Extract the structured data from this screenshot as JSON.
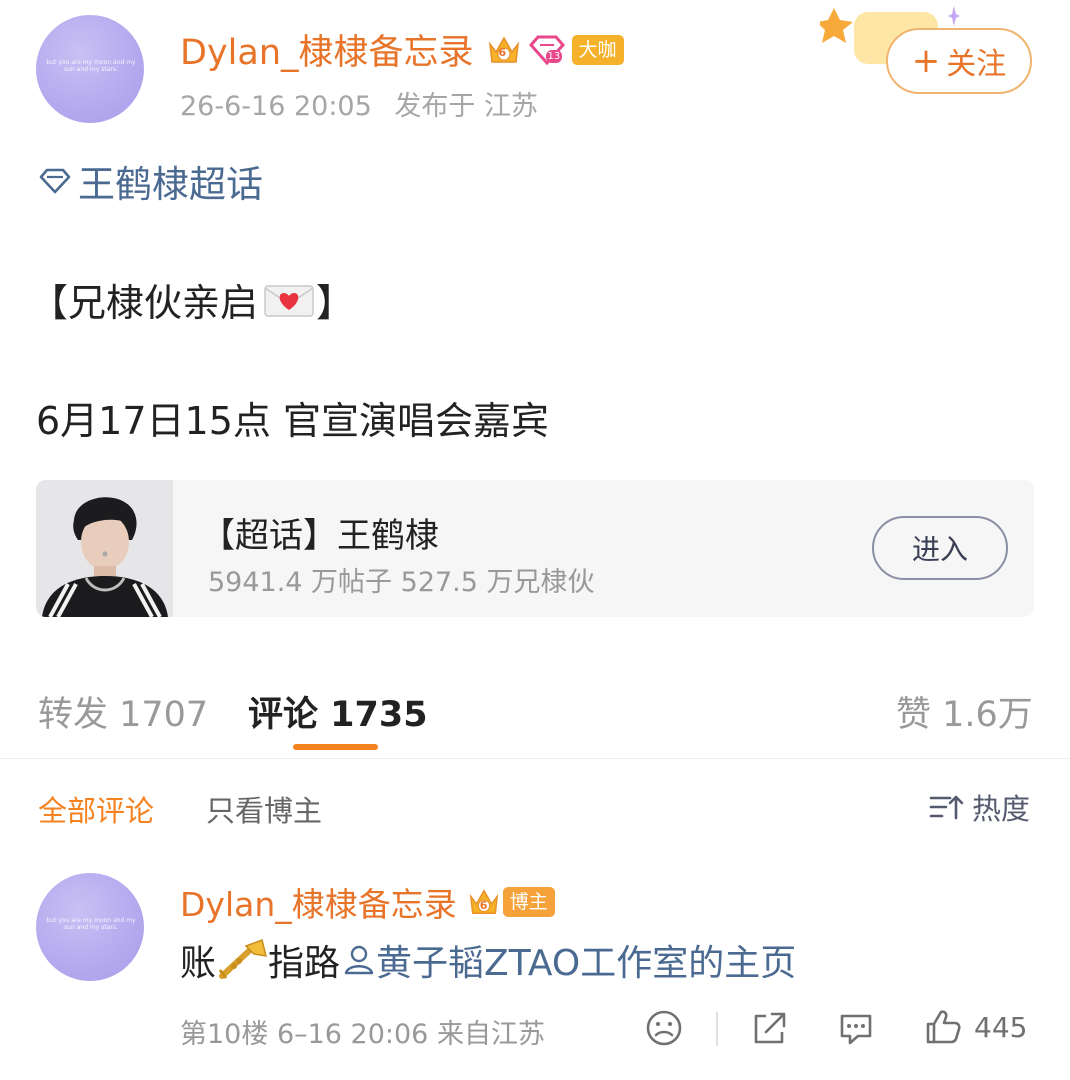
{
  "post": {
    "author": "Dylan_棣棣备忘录",
    "author_avatar_text": "but you are my moon and my sun and my stars.",
    "badge_level": "6",
    "badge_level2": "13",
    "badge_role": "大咖",
    "date": "26-6-16 20:05",
    "location": "发布于 江苏",
    "follow_label": "关注",
    "super_topic": "王鹤棣超话",
    "lines": [
      "【兄棣伙亲启",
      "6月17日15点 官宣演唱会嘉宾"
    ]
  },
  "card": {
    "title": "【超话】王鹤棣",
    "stats": "5941.4 万帖子 527.5 万兄棣伙",
    "enter_label": "进入"
  },
  "tabs": {
    "repost": "转发 1707",
    "comment": "评论 1735",
    "like": "赞 1.6万"
  },
  "filters": {
    "all": "全部评论",
    "owner_only": "只看博主",
    "sort": "热度"
  },
  "comment": {
    "author": "Dylan_棣棣备忘录",
    "badge_level": "6",
    "badge_role": "博主",
    "text_prefix": "账",
    "text_mid": "指路",
    "mention": "黄子韬ZTAO工作室的主页",
    "floor_meta": "第10楼  6–16 20:06  来自江苏",
    "likes": "445"
  },
  "colors": {
    "accent_orange": "#e8742a",
    "link_blue": "#4b6a92",
    "tab_indicator": "#f5821f"
  }
}
